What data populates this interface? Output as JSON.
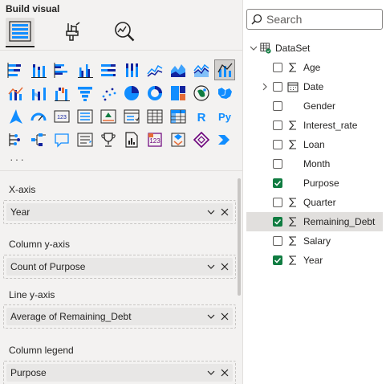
{
  "pane": {
    "title": "Build visual"
  },
  "tabs": [
    {
      "name": "build-visual-tab-icon"
    },
    {
      "name": "format-visual-tab-icon"
    },
    {
      "name": "analytics-tab-icon"
    }
  ],
  "gallery": {
    "rows": [
      [
        "stacked-bar",
        "stacked-column",
        "clustered-bar",
        "clustered-column",
        "100-stacked-bar",
        "100-stacked-column",
        "line",
        "area",
        "stacked-area",
        "line-clustered-column"
      ],
      [
        "line-stacked-column",
        "ribbon",
        "waterfall",
        "funnel",
        "scatter",
        "pie",
        "donut",
        "treemap",
        "map",
        "filled-map"
      ],
      [
        "azure-map",
        "gauge",
        "card",
        "multi-row-card",
        "kpi",
        "slicer",
        "table",
        "matrix",
        "r-script",
        "python-visual"
      ],
      [
        "key-influencers",
        "decomposition-tree",
        "qna",
        "smart-narrative",
        "metrics",
        "paginated-report",
        "power-apps",
        "power-automate",
        "diamond-visual",
        "chevron-visual"
      ]
    ],
    "selected": "line-clustered-column",
    "more_label": "···"
  },
  "wells": [
    {
      "label": "X-axis",
      "field": "Year"
    },
    {
      "label": "Column y-axis",
      "field": "Count of Purpose"
    },
    {
      "label": "Line y-axis",
      "field": "Average of Remaining_Debt"
    },
    {
      "label": "Column legend",
      "field": "Purpose"
    }
  ],
  "data_pane": {
    "search_placeholder": "Search",
    "table_name": "DataSet",
    "fields": [
      {
        "name": "Age",
        "type": "sigma",
        "checked": false
      },
      {
        "name": "Date",
        "type": "date",
        "checked": false,
        "expandable": true
      },
      {
        "name": "Gender",
        "type": "text",
        "checked": false
      },
      {
        "name": "Interest_rate",
        "type": "sigma",
        "checked": false
      },
      {
        "name": "Loan",
        "type": "sigma",
        "checked": false
      },
      {
        "name": "Month",
        "type": "text",
        "checked": false
      },
      {
        "name": "Purpose",
        "type": "text",
        "checked": true
      },
      {
        "name": "Quarter",
        "type": "sigma",
        "checked": false
      },
      {
        "name": "Remaining_Debt",
        "type": "sigma",
        "checked": true,
        "highlight": true
      },
      {
        "name": "Salary",
        "type": "sigma",
        "checked": false
      },
      {
        "name": "Year",
        "type": "sigma",
        "checked": true
      }
    ]
  },
  "colors": {
    "accent": "#107c41",
    "blue": "#118dff",
    "text": "#252423"
  }
}
